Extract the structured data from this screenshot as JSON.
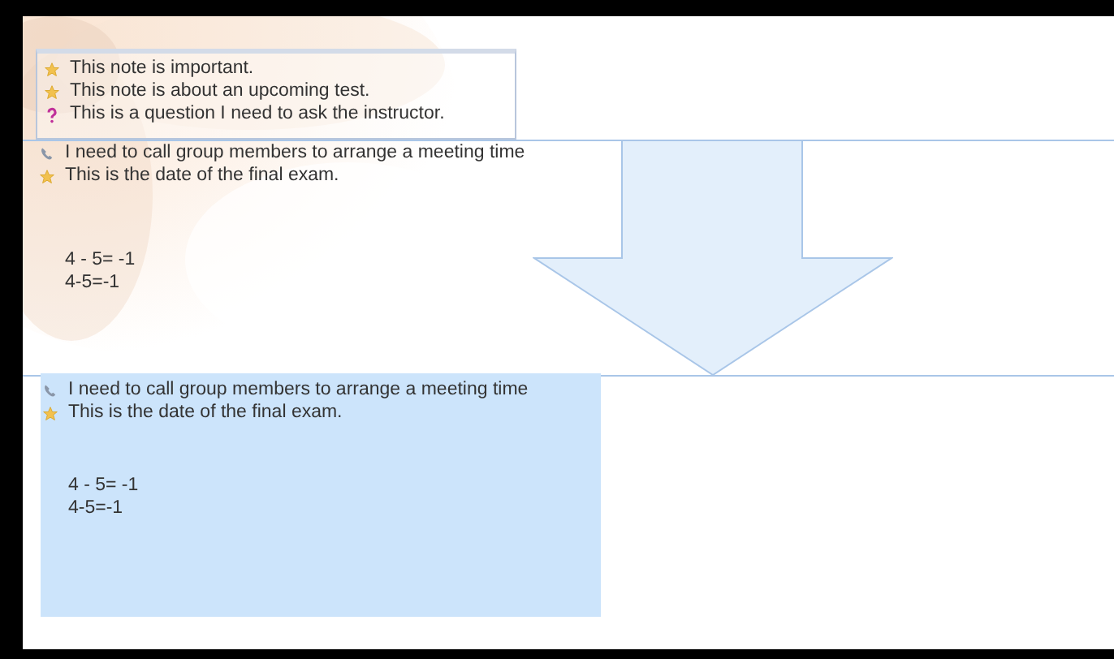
{
  "top_note": {
    "tagged_box": [
      {
        "kind": "star",
        "text": "This note is important."
      },
      {
        "kind": "star",
        "text": "This note is about an upcoming test."
      },
      {
        "kind": "question",
        "text": "This is a question I need to ask the instructor."
      }
    ],
    "lines": [
      {
        "kind": "phone",
        "text": "I need to call group members to arrange a meeting time"
      },
      {
        "kind": "star",
        "text": "This is the date of the final exam."
      }
    ],
    "equations": [
      "4 - 5= -1",
      "4-5=-1"
    ]
  },
  "bottom_note": {
    "selected": true,
    "lines": [
      {
        "kind": "phone",
        "text": "I need to call group members to arrange a meeting time"
      },
      {
        "kind": "star",
        "text": "This is the date of the final exam."
      }
    ],
    "equations": [
      "4 - 5= -1",
      "4-5=-1"
    ]
  }
}
